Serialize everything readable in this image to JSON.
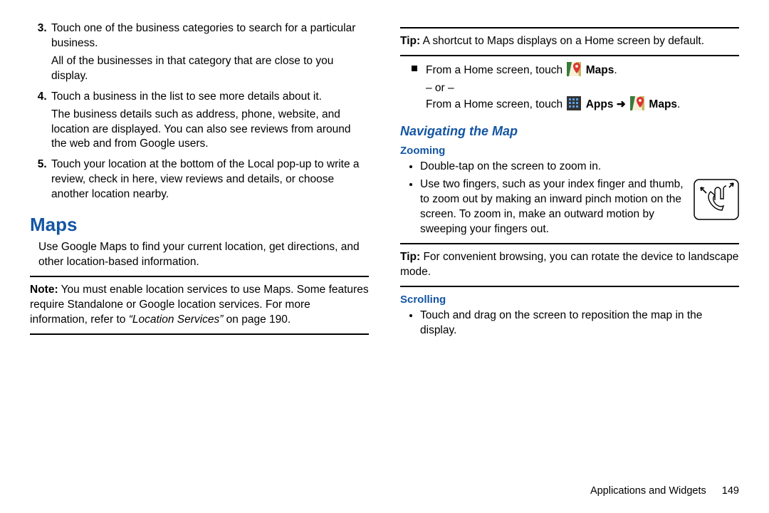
{
  "left": {
    "steps": [
      {
        "num": "3.",
        "main": "Touch one of the business categories to search for a particular business.",
        "extra": "All of the businesses in that category that are close to you display."
      },
      {
        "num": "4.",
        "main": "Touch a business in the list to see more details about it.",
        "extra": "The business details such as address, phone, website, and location are displayed. You can also see reviews from around the web and from Google users."
      },
      {
        "num": "5.",
        "main": "Touch your location at the bottom of the Local pop-up to write a review, check in here, view reviews and details, or choose another location nearby."
      }
    ],
    "maps_heading": "Maps",
    "maps_intro": "Use Google Maps to find your current location, get directions, and other location-based information.",
    "note_label": "Note:",
    "note_body": "You must enable location services to use Maps. Some features require Standalone or Google location services. For more information, refer to ",
    "note_link": "“Location Services”",
    "note_tail": " on page 190."
  },
  "right": {
    "tip1_label": "Tip:",
    "tip1_body": "A shortcut to Maps displays on a Home screen by default.",
    "from1_pre": "From a Home screen, touch ",
    "maps_label": "Maps",
    "or_text": "– or –",
    "from2_pre": "From a Home screen, touch ",
    "apps_label": "Apps",
    "arrow": " ➜ ",
    "nav_heading": "Navigating the Map",
    "zooming_heading": "Zooming",
    "zoom_b1": "Double-tap on the screen to zoom in.",
    "zoom_b2": "Use two fingers, such as your index finger and thumb, to zoom out by making an inward pinch motion on the screen. To zoom in, make an outward motion by sweeping your fingers out.",
    "tip2_label": "Tip:",
    "tip2_body": "For convenient browsing, you can rotate the device to landscape mode.",
    "scrolling_heading": "Scrolling",
    "scroll_b1": "Touch and drag on the screen to reposition the map in the display."
  },
  "footer": {
    "section": "Applications and Widgets",
    "page": "149"
  }
}
